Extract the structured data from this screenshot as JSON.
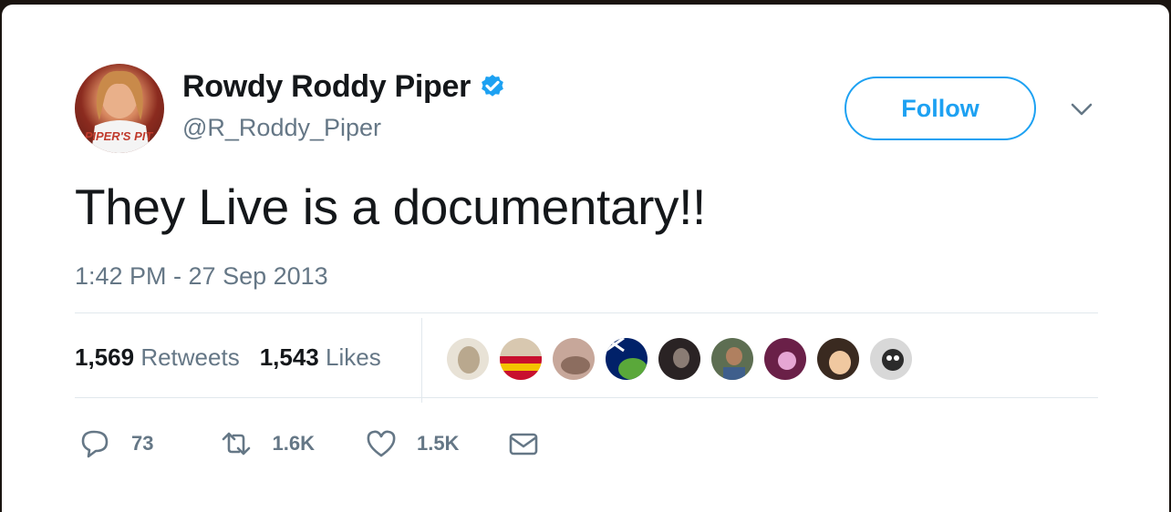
{
  "user": {
    "name": "Rowdy Roddy Piper",
    "handle": "@R_Roddy_Piper",
    "avatar_caption": "PIPER'S PIT"
  },
  "follow_label": "Follow",
  "tweet": {
    "text": "They Live is a documentary!!",
    "timestamp": "1:42 PM - 27 Sep 2013"
  },
  "stats": {
    "retweets_count": "1,569",
    "retweets_label": "Retweets",
    "likes_count": "1,543",
    "likes_label": "Likes"
  },
  "actions": {
    "replies": "73",
    "retweets": "1.6K",
    "likes": "1.5K"
  },
  "colors": {
    "accent": "#1da1f2",
    "text": "#14171a",
    "muted": "#657786",
    "border": "#e1e8ed"
  }
}
